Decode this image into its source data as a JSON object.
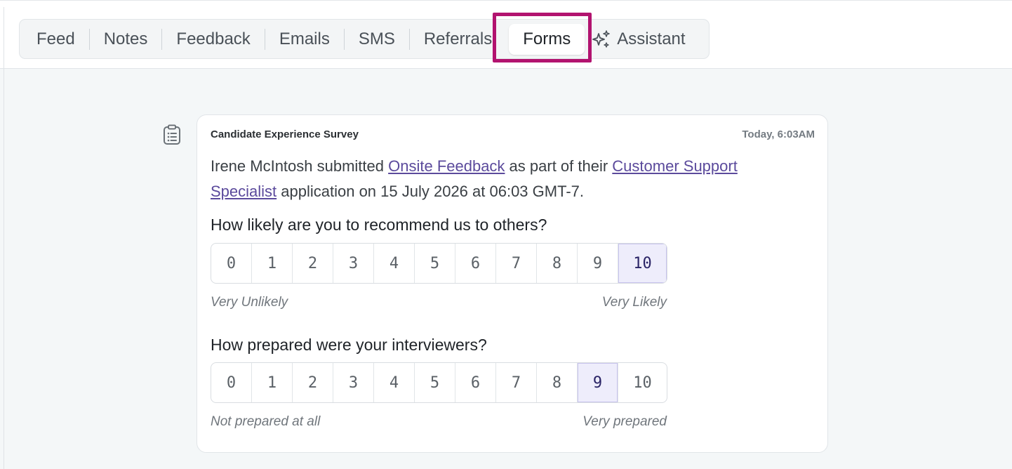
{
  "tabs": [
    {
      "label": "Feed"
    },
    {
      "label": "Notes"
    },
    {
      "label": "Feedback"
    },
    {
      "label": "Emails"
    },
    {
      "label": "SMS"
    },
    {
      "label": "Referrals"
    },
    {
      "label": "Forms",
      "active": true
    },
    {
      "label": "Assistant",
      "icon": "sparkle-icon"
    }
  ],
  "card": {
    "icon": "clipboard-icon",
    "title": "Candidate Experience Survey",
    "timestamp": "Today, 6:03AM",
    "desc_prefix": "Irene McIntosh submitted ",
    "form_link": "Onsite Feedback",
    "desc_middle": " as part of their ",
    "job_link": "Customer Support Specialist",
    "desc_suffix": " application on 15 July 2026 at 06:03 GMT-7."
  },
  "questions": [
    {
      "text": "How likely are you to recommend us to others?",
      "options": [
        "0",
        "1",
        "2",
        "3",
        "4",
        "5",
        "6",
        "7",
        "8",
        "9",
        "10"
      ],
      "selected": "10",
      "low_label": "Very Unlikely",
      "high_label": "Very Likely"
    },
    {
      "text": "How prepared were your interviewers?",
      "options": [
        "0",
        "1",
        "2",
        "3",
        "4",
        "5",
        "6",
        "7",
        "8",
        "9",
        "10"
      ],
      "selected": "9",
      "low_label": "Not prepared at all",
      "high_label": "Very prepared"
    }
  ],
  "colors": {
    "highlight": "#b2136f",
    "link": "#5b4a9c",
    "selected_bg": "#eeedfb"
  }
}
